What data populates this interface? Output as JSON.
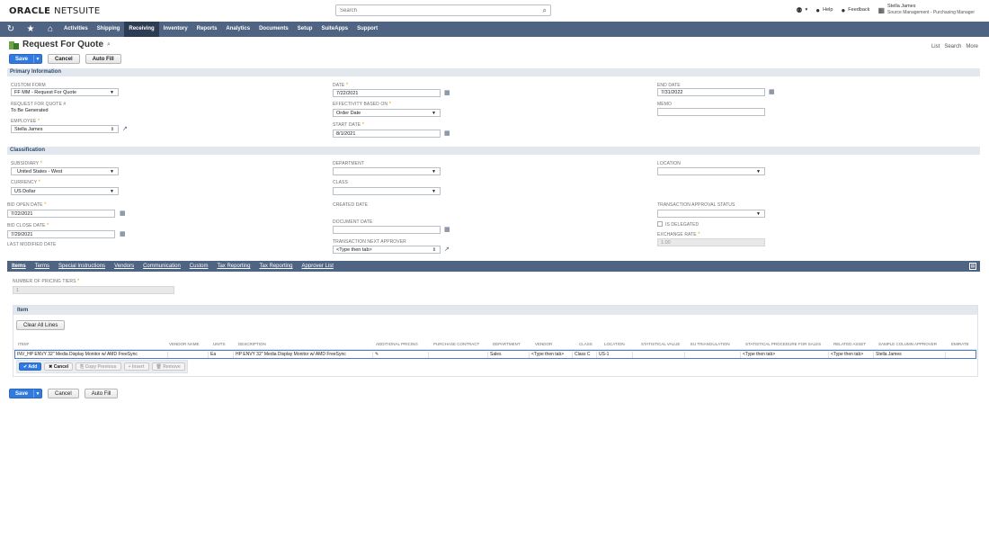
{
  "header": {
    "logo_brand": "ORACLE",
    "logo_product": "NETSUITE",
    "search_placeholder": "Search",
    "help_label": "Help",
    "feedback_label": "Feedback",
    "user_name": "Stella James",
    "user_role": "Source Management - Purchasing Manager"
  },
  "nav": {
    "items": [
      "Activities",
      "Shipping",
      "Receiving",
      "Inventory",
      "Reports",
      "Analytics",
      "Documents",
      "Setup",
      "SuiteApps",
      "Support"
    ],
    "active": "Receiving"
  },
  "page": {
    "title": "Request For Quote",
    "links": [
      "List",
      "Search",
      "More"
    ]
  },
  "buttons": {
    "save": "Save",
    "cancel": "Cancel",
    "auto_fill": "Auto Fill"
  },
  "primary": {
    "section_title": "Primary Information",
    "custom_form_label": "CUSTOM FORM",
    "custom_form_value": "FF MM - Request For Quote",
    "rfq_label": "REQUEST FOR QUOTE #",
    "rfq_value": "To Be Generated",
    "employee_label": "EMPLOYEE",
    "employee_value": "Stella James",
    "date_label": "DATE",
    "date_value": "7/22/2021",
    "effectivity_label": "EFFECTIVITY BASED ON",
    "effectivity_value": "Order Date",
    "start_date_label": "START DATE",
    "start_date_value": "8/1/2021",
    "end_date_label": "END DATE",
    "end_date_value": "7/31/2022",
    "memo_label": "MEMO",
    "memo_value": ""
  },
  "classification": {
    "section_title": "Classification",
    "subsidiary_label": "SUBSIDIARY",
    "subsidiary_value": "United States - West",
    "currency_label": "CURRENCY",
    "currency_value": "US Dollar",
    "bid_open_label": "BID OPEN DATE",
    "bid_open_value": "7/22/2021",
    "bid_close_label": "BID CLOSE DATE",
    "bid_close_value": "7/29/2021",
    "last_modified_label": "LAST MODIFIED DATE",
    "department_label": "DEPARTMENT",
    "class_label": "CLASS",
    "created_date_label": "CREATED DATE",
    "document_date_label": "DOCUMENT DATE",
    "next_approver_label": "TRANSACTION NEXT APPROVER",
    "next_approver_value": "<Type then tab>",
    "location_label": "LOCATION",
    "approval_status_label": "TRANSACTION APPROVAL STATUS",
    "is_delegated_label": "IS DELEGATED",
    "exchange_rate_label": "EXCHANGE RATE",
    "exchange_rate_value": "1.00"
  },
  "tabs": [
    "Items",
    "Terms",
    "Special Instructions",
    "Vendors",
    "Communication",
    "Custom",
    "Tax Reporting",
    "Tax Reporting",
    "Approver List"
  ],
  "items_tab": {
    "pricing_tiers_label": "NUMBER OF PRICING TIERS",
    "pricing_tiers_value": "1",
    "box_title": "Item",
    "clear_all_label": "Clear All Lines",
    "columns": [
      "ITEM",
      "VENDOR NAME",
      "UNITS",
      "DESCRIPTION",
      "ADDITIONAL PRICING",
      "PURCHASE CONTRACT",
      "DEPARTMENT",
      "VENDOR",
      "CLASS",
      "LOCATION",
      "STATISTICAL VALUE",
      "EU TRIANGULATION",
      "STATISTICAL PROCEDURE FOR SALES",
      "RELATED ASSET",
      "SAMPLE COLUMN APPROVER",
      "EMIRATE"
    ],
    "row": {
      "item": "INV_HP ENVY 32\" Media Display Monitor w/ AMD FreeSync",
      "units": "Ea",
      "description": "HP ENVY 32\" Media Display Monitor w/ AMD FreeSync",
      "department": "Sales",
      "vendor": "<Type then tab>",
      "class": "Class C",
      "location": "US-1",
      "stat_proc": "<Type then tab>",
      "related_asset": "<Type then tab>",
      "sample_approver": "Stella James"
    },
    "line_buttons": {
      "add": "Add",
      "cancel": "Cancel",
      "copy_previous": "Copy Previous",
      "insert": "Insert",
      "remove": "Remove"
    }
  }
}
